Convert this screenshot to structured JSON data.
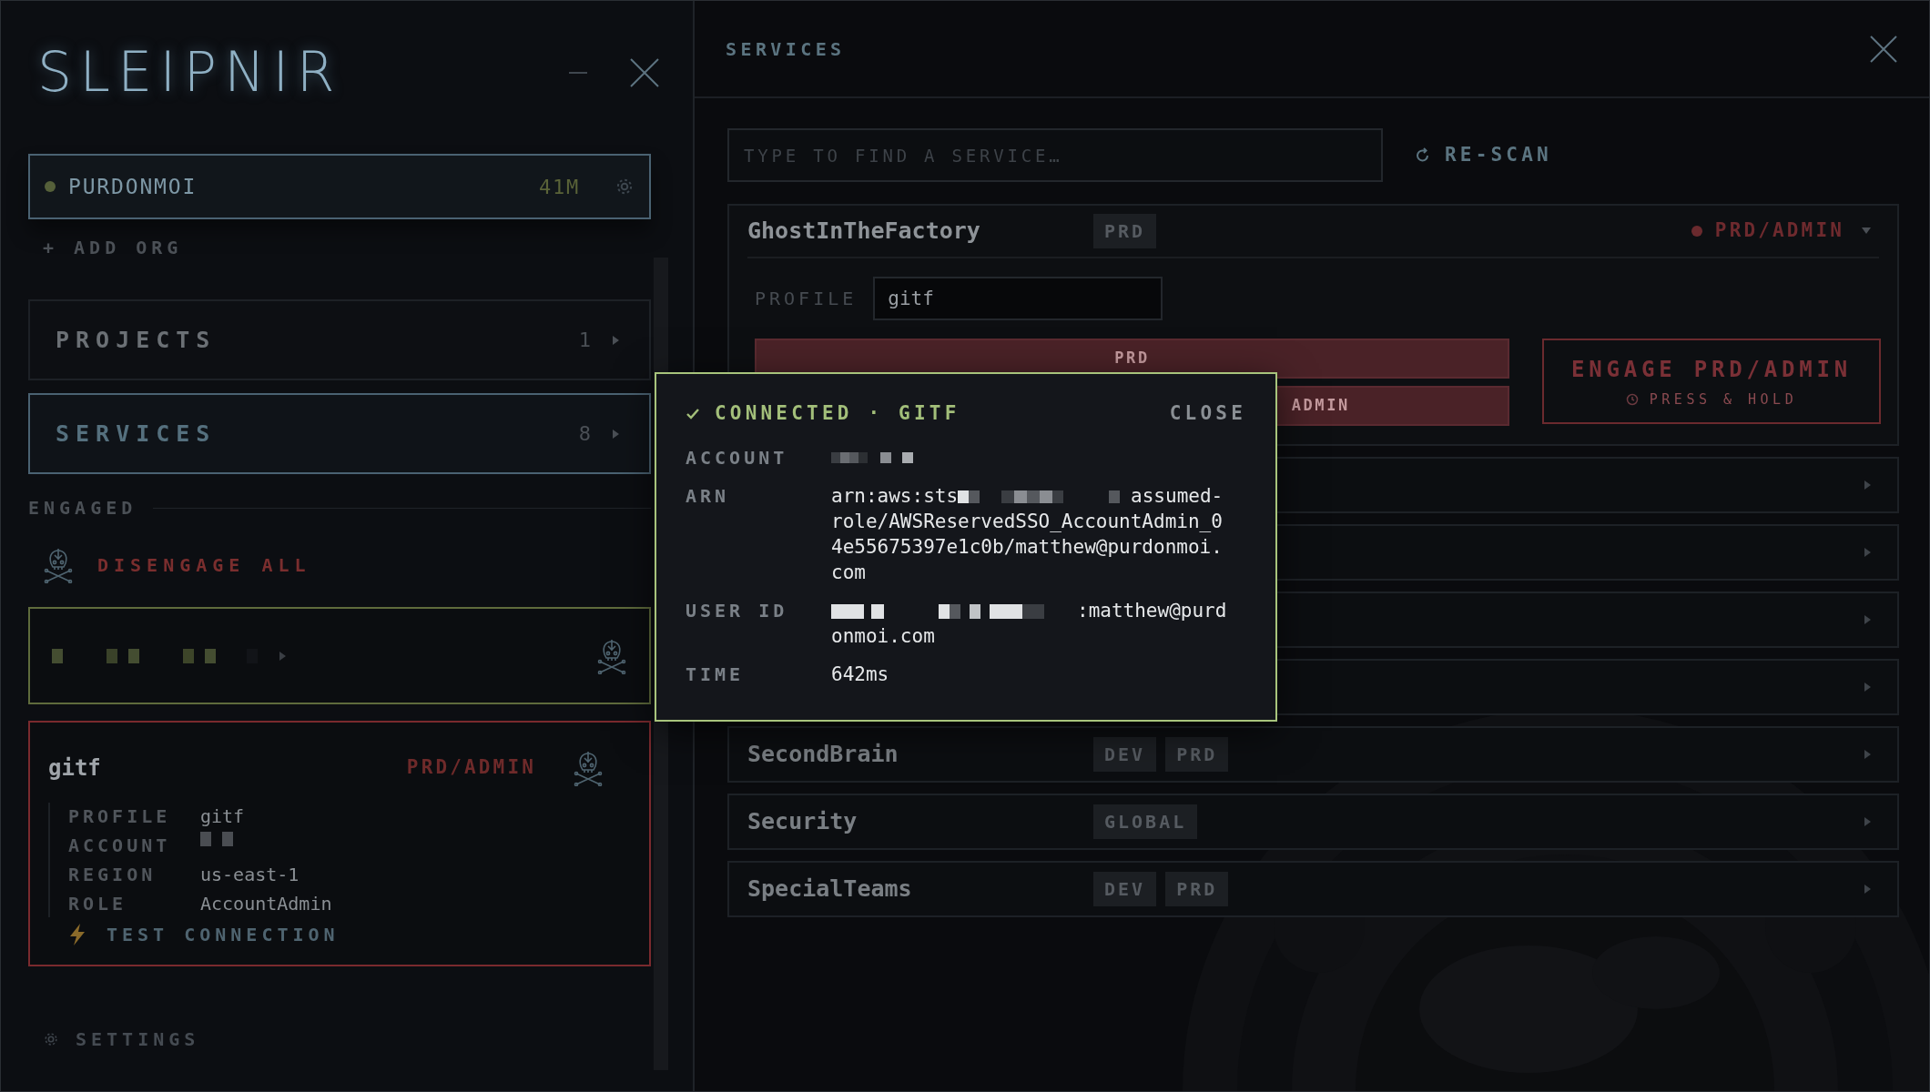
{
  "app": {
    "logo": "SLEIPNIR"
  },
  "org": {
    "name": "PURDONMOI",
    "age": "41M",
    "color": "#55603a"
  },
  "add_org": "+ ADD ORG",
  "nav": [
    {
      "label": "PROJECTS",
      "count": "1",
      "selected": false
    },
    {
      "label": "SERVICES",
      "count": "8",
      "selected": true
    }
  ],
  "engaged": {
    "title": "ENGAGED",
    "disengage_all": "DISENGAGE ALL",
    "items": [
      {
        "kind": "collapsed",
        "color": "#5f6b3c"
      },
      {
        "kind": "expanded",
        "color": "#7a2a2e",
        "name": "gitf",
        "role": "PRD/ADMIN",
        "test_connection": "TEST CONNECTION",
        "details": [
          {
            "label": "PROFILE",
            "kind": "text",
            "value": "gitf"
          },
          {
            "label": "ACCOUNT",
            "kind": "redacted"
          },
          {
            "label": "REGION",
            "kind": "text",
            "value": "us-east-1"
          },
          {
            "label": "ROLE",
            "kind": "text",
            "value": "AccountAdmin"
          }
        ]
      }
    ]
  },
  "settings": "SETTINGS",
  "panel": {
    "title": "SERVICES",
    "search": {
      "placeholder": "TYPE TO FIND A SERVICE…"
    },
    "rescan": "RE-SCAN"
  },
  "services": [
    {
      "name": "GhostInTheFactory",
      "tags": [
        "PRD"
      ],
      "expanded": true,
      "status": "PRD/ADMIN",
      "profile_label": "PROFILE",
      "profile": "gitf",
      "options": [
        {
          "label": "PRD",
          "selected": true
        },
        {
          "label": "ADMIN",
          "selected": true
        }
      ],
      "engage": {
        "label": "ENGAGE PRD/ADMIN",
        "hint": "PRESS & HOLD"
      }
    },
    {
      "expanded": false
    },
    {
      "expanded": false
    },
    {
      "expanded": false
    },
    {
      "expanded": false
    },
    {
      "name": "SecondBrain",
      "tags": [
        "DEV",
        "PRD"
      ],
      "expanded": false
    },
    {
      "name": "Security",
      "tags": [
        "GLOBAL"
      ],
      "expanded": false
    },
    {
      "name": "SpecialTeams",
      "tags": [
        "DEV",
        "PRD"
      ],
      "expanded": false
    }
  ],
  "popup": {
    "title": "CONNECTED · GITF",
    "close": "CLOSE",
    "fields": [
      {
        "label": "ACCOUNT",
        "kind": "redacted"
      },
      {
        "label": "ARN",
        "kind": "arn",
        "prefix": "arn:aws:sts",
        "value": "assumed-role/AWSReservedSSO_AccountAdmin_04e55675397e1c0b/matthew@purdonmoi.com"
      },
      {
        "label": "USER ID",
        "kind": "userid",
        "value": ":matthew@purdonmoi.com"
      },
      {
        "label": "TIME",
        "kind": "text",
        "value": "642ms"
      }
    ]
  }
}
